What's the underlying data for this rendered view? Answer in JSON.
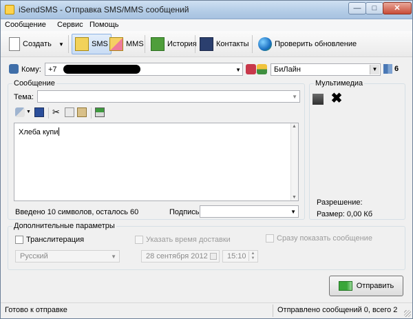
{
  "window": {
    "title": "iSendSMS - Отправка SMS/MMS сообщений",
    "minimize_icon": "minimize-icon",
    "maximize_icon": "maximize-icon",
    "close_icon": "close-icon"
  },
  "menu": {
    "items": [
      "Сообщение",
      "Сервис",
      "Помощь"
    ]
  },
  "toolbar": {
    "create_label": "Создать",
    "sms_label": "SMS",
    "mms_label": "MMS",
    "history_label": "История",
    "contacts_label": "Контакты",
    "update_label": "Проверить обновление",
    "sms_selected": true
  },
  "recipient": {
    "label": "Кому:",
    "phone_prefix": "+7",
    "operator": "БиЛайн",
    "count": "6"
  },
  "message": {
    "group_title": "Сообщение",
    "subject_label": "Тема:",
    "subject_value": "",
    "body": "Хлеба купи",
    "counter_text": "Введено 10 символов, осталось 60",
    "signature_label": "Подпись",
    "signature_value": ""
  },
  "multimedia": {
    "group_title": "Мультимедиа",
    "resolution_label": "Разрешение:",
    "size_label": "Размер: 0,00 Кб"
  },
  "advanced": {
    "group_title": "Дополнительные параметры",
    "transliteration_label": "Транслитерация",
    "transliteration_checked": false,
    "delivery_time_label": "Указать время доставки",
    "show_immediately_label": "Сразу показать сообщение",
    "language_value": "Русский",
    "date_value": "28 сентября 2012",
    "time_value": "15:10"
  },
  "send_button": {
    "label": "Отправить"
  },
  "status": {
    "left": "Готово к отправке",
    "right": "Отправлено сообщений 0, всего 2"
  }
}
